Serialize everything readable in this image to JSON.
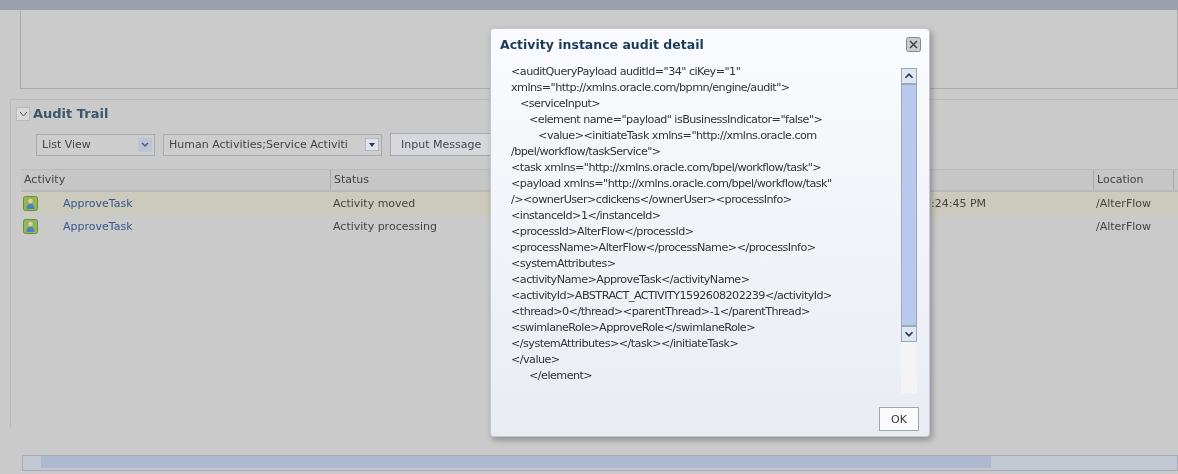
{
  "audit_trail": {
    "title": "Audit Trail",
    "expanded": true,
    "view_select": {
      "value": "List View"
    },
    "filter_select": {
      "value": "Human Activities;Service Activiti"
    },
    "buttons": [
      "Input Message"
    ],
    "table": {
      "columns": [
        "Activity",
        "Status",
        "",
        "Location"
      ],
      "rows": [
        {
          "activity": "ApproveTask",
          "status": "Activity moved",
          "column_3": ":24:45 PM",
          "location": "/AlterFlow",
          "selected": true
        },
        {
          "activity": "ApproveTask",
          "status": "Activity processing",
          "column_3": "",
          "location": "/AlterFlow",
          "selected": false
        }
      ]
    }
  },
  "dialog": {
    "title": "Activity instance audit detail",
    "lines": [
      "<auditQueryPayload auditId=\"34\" ciKey=\"1\"",
      "xmlns=\"http://xmlns.oracle.com/bpmn/engine/audit\">",
      "   <serviceInput>",
      "      <element name=\"payload\" isBusinessIndicator=\"false\">",
      "         <value><initiateTask xmlns=\"http://xmlns.oracle.com",
      "/bpel/workflow/taskService\">",
      "<task xmlns=\"http://xmlns.oracle.com/bpel/workflow/task\">",
      "<payload xmlns=\"http://xmlns.oracle.com/bpel/workflow/task\"",
      "/><ownerUser>cdickens</ownerUser><processInfo>",
      "<instanceId>1</instanceId>",
      "<processId>AlterFlow</processId>",
      "<processName>AlterFlow</processName></processInfo>",
      "<systemAttributes>",
      "<activityName>ApproveTask</activityName>",
      "<activityId>ABSTRACT_ACTIVITY1592608202239</activityId>",
      "<thread>0</thread><parentThread>-1</parentThread>",
      "<swimlaneRole>ApproveRole</swimlaneRole>",
      "</systemAttributes></task></initiateTask>",
      "</value>",
      "      </element>"
    ],
    "ok_button": "OK"
  }
}
